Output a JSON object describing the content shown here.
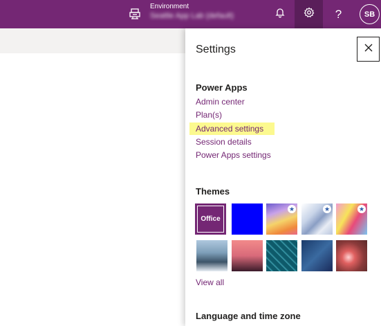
{
  "header": {
    "environment_label": "Environment",
    "environment_name": "Seattle App Lab (default)",
    "icons": [
      "environment-icon",
      "bell-icon",
      "gear-icon",
      "help-icon"
    ],
    "help_glyph": "?",
    "avatar_initials": "SB",
    "accent_color": "#742774"
  },
  "settings_panel": {
    "title": "Settings",
    "close_icon": "close-icon",
    "power_apps": {
      "heading": "Power Apps",
      "links": [
        "Admin center",
        "Plan(s)",
        "Advanced settings",
        "Session details",
        "Power Apps settings"
      ],
      "highlighted": "Advanced settings"
    },
    "themes": {
      "heading": "Themes",
      "selected_label": "Office",
      "view_all": "View all"
    },
    "language": {
      "heading": "Language and time zone"
    }
  }
}
